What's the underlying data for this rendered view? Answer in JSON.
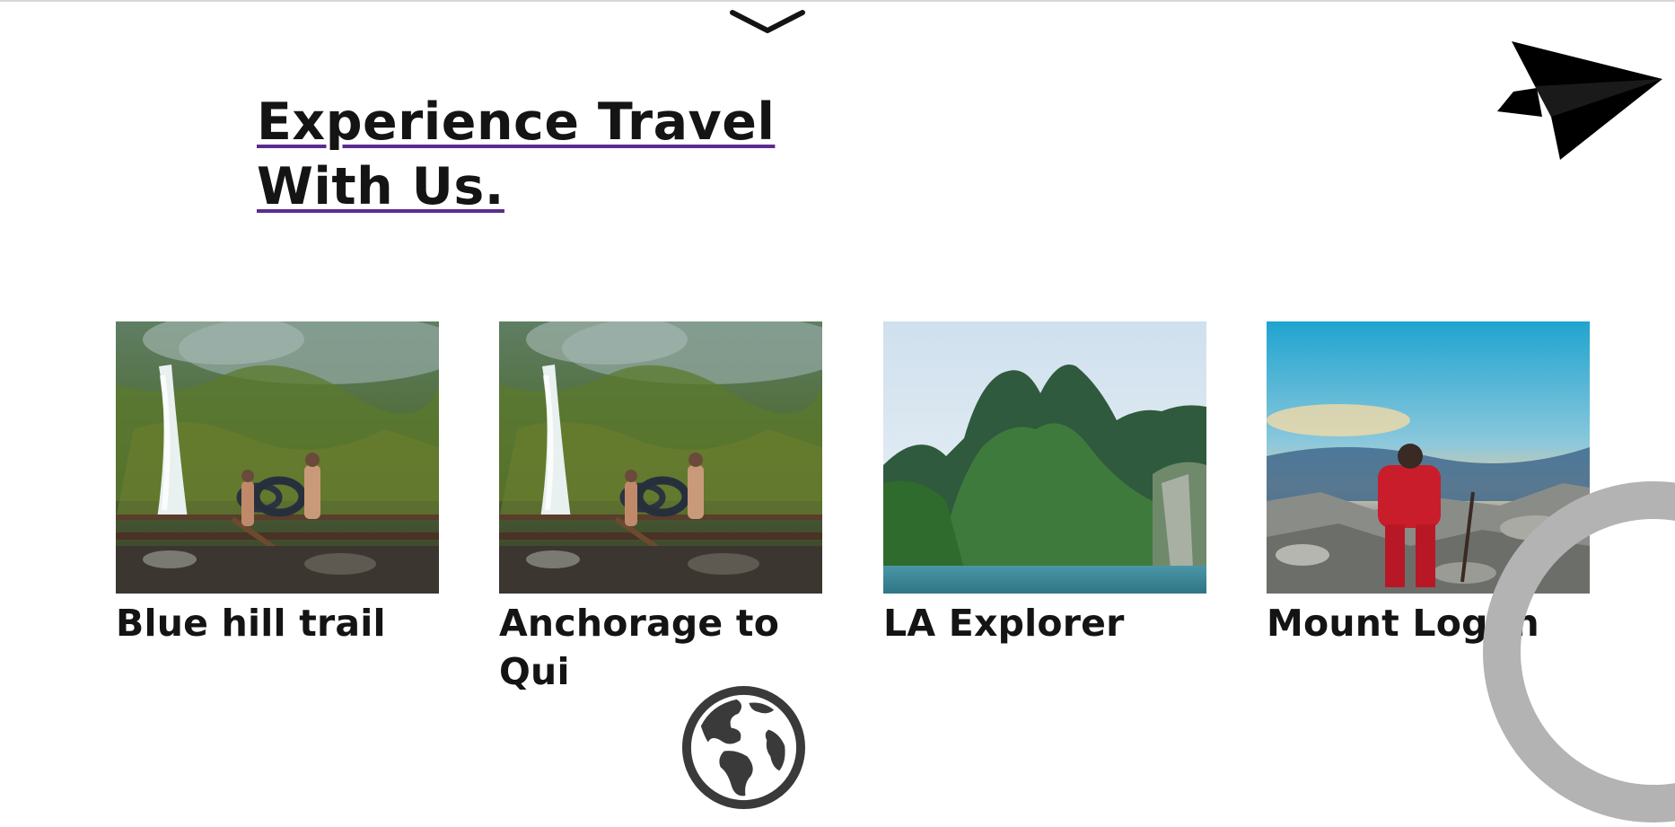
{
  "header": {
    "headline_line1": "Experience Travel",
    "headline_line2": "With Us."
  },
  "icons": {
    "top": "chevron-down-icon",
    "top_right": "paper-plane-icon",
    "bottom": "globe-icon",
    "bottom_right": "ring-decoration"
  },
  "colors": {
    "link_underline": "#5b2c8f",
    "text": "#141414",
    "ring": "#b3b3b3"
  },
  "trips": [
    {
      "title": "Blue hill trail",
      "image": "waterfall-hikers-photo"
    },
    {
      "title": "Anchorage to Qui",
      "image": "waterfall-hikers-photo"
    },
    {
      "title": "LA Explorer",
      "image": "green-mountains-lake-photo"
    },
    {
      "title": "Mount Logan",
      "image": "hiker-red-jacket-photo"
    }
  ]
}
